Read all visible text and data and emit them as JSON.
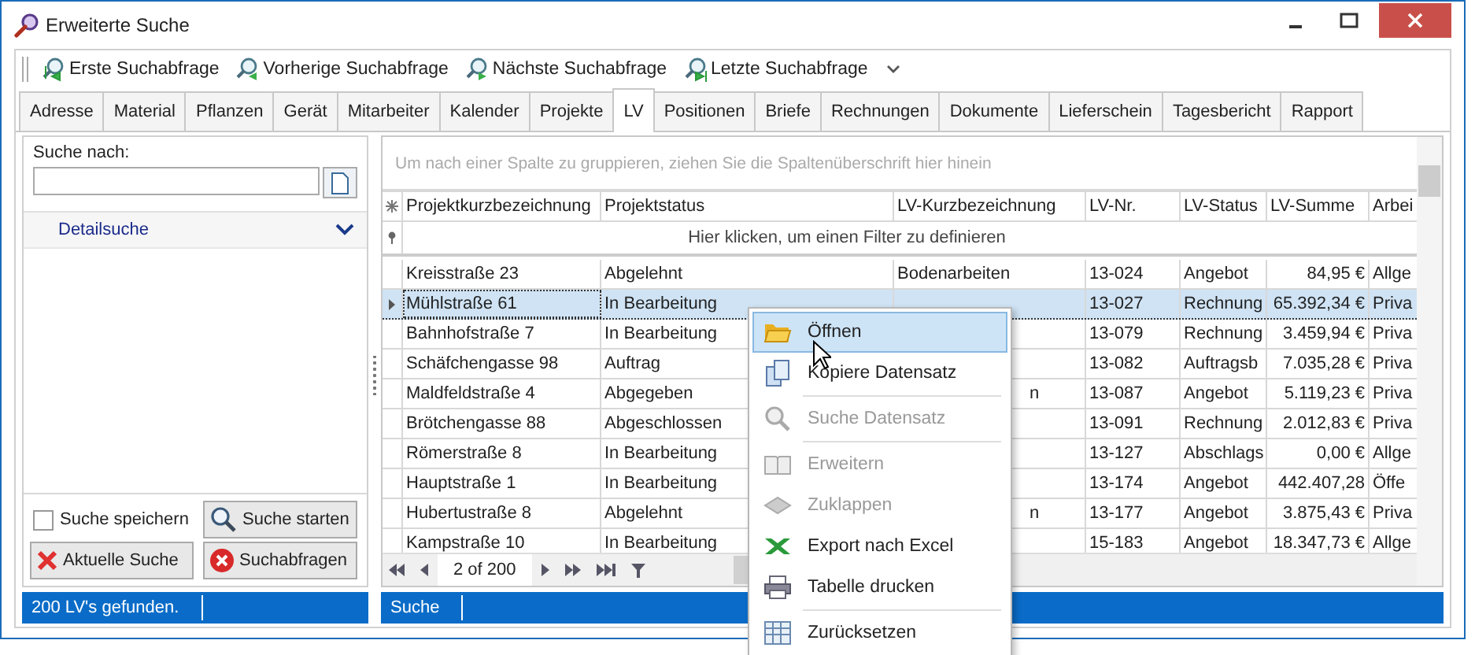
{
  "window": {
    "title": "Erweiterte Suche"
  },
  "toolbar": [
    {
      "label": "Erste Suchabfrage",
      "kind": "first"
    },
    {
      "label": "Vorherige Suchabfrage",
      "kind": "prev"
    },
    {
      "label": "Nächste Suchabfrage",
      "kind": "next"
    },
    {
      "label": "Letzte Suchabfrage",
      "kind": "last"
    }
  ],
  "tabs": [
    {
      "label": "Adresse",
      "selected": false
    },
    {
      "label": "Material",
      "selected": false
    },
    {
      "label": "Pflanzen",
      "selected": false
    },
    {
      "label": "Gerät",
      "selected": false
    },
    {
      "label": "Mitarbeiter",
      "selected": false
    },
    {
      "label": "Kalender",
      "selected": false
    },
    {
      "label": "Projekte",
      "selected": false
    },
    {
      "label": "LV",
      "selected": true
    },
    {
      "label": "Positionen",
      "selected": false
    },
    {
      "label": "Briefe",
      "selected": false
    },
    {
      "label": "Rechnungen",
      "selected": false
    },
    {
      "label": "Dokumente",
      "selected": false
    },
    {
      "label": "Lieferschein",
      "selected": false
    },
    {
      "label": "Tagesbericht",
      "selected": false
    },
    {
      "label": "Rapport",
      "selected": false
    }
  ],
  "search_panel": {
    "label": "Suche nach:",
    "detail_label": "Detailsuche",
    "save_search": {
      "label": "Suche speichern",
      "checked": false
    },
    "buttons": [
      {
        "label": "Suche starten",
        "kind": "search"
      },
      {
        "label": "Aktuelle Suche",
        "kind": "clear"
      },
      {
        "label": "Suchabfragen",
        "kind": "delete"
      }
    ],
    "status": "200 LV's gefunden."
  },
  "grid": {
    "group_hint": "Um nach einer Spalte zu gruppieren, ziehen Sie die Spaltenüberschrift hier hinein",
    "columns": [
      "Projektkurzbezeichnung",
      "Projektstatus",
      "LV-Kurzbezeichnung",
      "LV-Nr.",
      "LV-Status",
      "LV-Summe",
      "Arbei"
    ],
    "filter_hint": "Hier klicken, um einen Filter zu definieren",
    "rows": [
      {
        "selected": false,
        "cells": [
          "Kreisstraße 23",
          "Abgelehnt",
          "Bodenarbeiten",
          "13-024",
          "Angebot",
          "84,95 €",
          "Allge"
        ]
      },
      {
        "selected": true,
        "cells": [
          "Mühlstraße 61",
          "In Bearbeitung",
          null,
          "13-027",
          "Rechnung",
          "65.392,34 €",
          "Priva"
        ]
      },
      {
        "selected": false,
        "cells": [
          "Bahnhofstraße 7",
          "In Bearbeitung",
          null,
          "13-079",
          "Rechnung",
          "3.459,94 €",
          "Priva"
        ]
      },
      {
        "selected": false,
        "cells": [
          "Schäfchengasse 98",
          "Auftrag",
          null,
          "13-082",
          "Auftragsb",
          "7.035,28 €",
          "Priva"
        ]
      },
      {
        "selected": false,
        "cells": [
          "Maldfeldstraße 4",
          "Abgegeben",
          {
            "kind": "tail",
            "text": "n"
          },
          "13-087",
          "Angebot",
          "5.119,23 €",
          "Priva"
        ]
      },
      {
        "selected": false,
        "cells": [
          "Brötchengasse 88",
          "Abgeschlossen",
          null,
          "13-091",
          "Rechnung",
          "2.012,83 €",
          "Priva"
        ]
      },
      {
        "selected": false,
        "cells": [
          "Römerstraße 8",
          "In Bearbeitung",
          null,
          "13-127",
          "Abschlags",
          "0,00 €",
          "Allge"
        ]
      },
      {
        "selected": false,
        "cells": [
          "Hauptstraße 1",
          "In Bearbeitung",
          null,
          "13-174",
          "Angebot",
          "442.407,28",
          "Öffe"
        ]
      },
      {
        "selected": false,
        "cells": [
          "Hubertustraße 8",
          "Abgelehnt",
          {
            "kind": "tail",
            "text": "n"
          },
          "13-177",
          "Angebot",
          "3.875,43 €",
          "Priva"
        ]
      },
      {
        "selected": false,
        "cells": [
          "Kampstraße 10",
          "In Bearbeitung",
          null,
          "15-183",
          "Angebot",
          "18.347,73 €",
          "Allge"
        ]
      }
    ],
    "pager": "2 of 200",
    "status": "Suche"
  },
  "context_menu": [
    {
      "label": "Öffnen",
      "kind": "open",
      "disabled": false,
      "selected": true,
      "separator": false
    },
    {
      "label": "Kopiere Datensatz",
      "kind": "copy",
      "disabled": false,
      "selected": false,
      "separator": true
    },
    {
      "label": "Suche Datensatz",
      "kind": "find",
      "disabled": true,
      "selected": false,
      "separator": true
    },
    {
      "label": "Erweitern",
      "kind": "expand",
      "disabled": true,
      "selected": false,
      "separator": false
    },
    {
      "label": "Zuklappen",
      "kind": "collapse",
      "disabled": true,
      "selected": false,
      "separator": false
    },
    {
      "label": "Export nach Excel",
      "kind": "excel",
      "disabled": false,
      "selected": false,
      "separator": false
    },
    {
      "label": "Tabelle drucken",
      "kind": "print",
      "disabled": false,
      "selected": false,
      "separator": true
    },
    {
      "label": "Zurücksetzen",
      "kind": "reset",
      "disabled": false,
      "selected": false,
      "separator": false
    }
  ]
}
